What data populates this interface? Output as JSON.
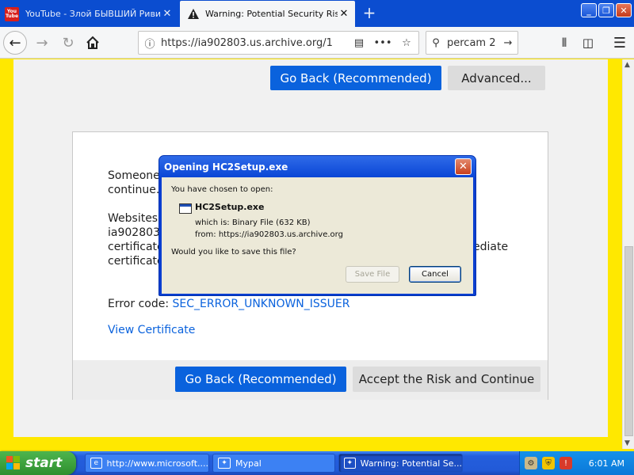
{
  "browser": {
    "tabs": [
      {
        "label": "YouTube - Злой БЫВШИЙ Риви Х",
        "icon": "youtube-icon",
        "close": "✕"
      },
      {
        "label": "Warning: Potential Security Risk Ah",
        "icon": "warning-icon",
        "close": "✕"
      }
    ],
    "new_tab": "+",
    "window_controls": {
      "minimize": "_",
      "maximize": "❐",
      "close": "✕"
    },
    "url": "https://ia902803.us.archive.org/1",
    "search_value": "percam 2",
    "nav_icons": [
      "back-icon",
      "forward-icon",
      "reload-icon",
      "home-icon",
      "info-icon",
      "reader-icon",
      "page-actions-icon",
      "bookmark-star-icon",
      "search-icon",
      "go-arrow-icon",
      "library-icon",
      "sidebar-icon",
      "menu-icon"
    ]
  },
  "page": {
    "top_goback_label": "Go Back (Recommended)",
    "top_advanced_label": "Advanced...",
    "para1_line1": "Someone",
    "para1_line2": "continue.",
    "para2_line1": "Websites",
    "para2_line2": "ia902803.",
    "para2_line3": "certificate",
    "para2_line4": "certificate",
    "para2_tail": "ediate",
    "error_code_label": "Error code:",
    "error_code_value": "SEC_ERROR_UNKNOWN_ISSUER",
    "view_certificate": "View Certificate",
    "bottom_goback_label": "Go Back (Recommended)",
    "accept_risk_label": "Accept the Risk and Continue"
  },
  "dialog": {
    "title": "Opening HC2Setup.exe",
    "close": "✕",
    "chosen_text": "You have chosen to open:",
    "filename": "HC2Setup.exe",
    "which_is": "which is:  Binary File (632 KB)",
    "from": "from:  https://ia902803.us.archive.org",
    "question": "Would you like to save this file?",
    "save_label": "Save File",
    "cancel_label": "Cancel"
  },
  "taskbar": {
    "start_label": "start",
    "items": [
      {
        "label": "http://www.microsoft....",
        "icon": "internet-explorer-icon"
      },
      {
        "label": "Mypal",
        "icon": "mypal-icon"
      },
      {
        "label": "Warning: Potential Se...",
        "icon": "mypal-icon"
      }
    ],
    "tray_icons": [
      "network-icon",
      "shield-icon",
      "security-alert-icon"
    ],
    "clock": "6:01 AM"
  },
  "colors": {
    "background": "#ffe800",
    "accent_blue": "#0a62dd",
    "xp_titlebar": "#0a46d6",
    "taskbar": "#245edc",
    "start_green": "#3a9e3a"
  }
}
